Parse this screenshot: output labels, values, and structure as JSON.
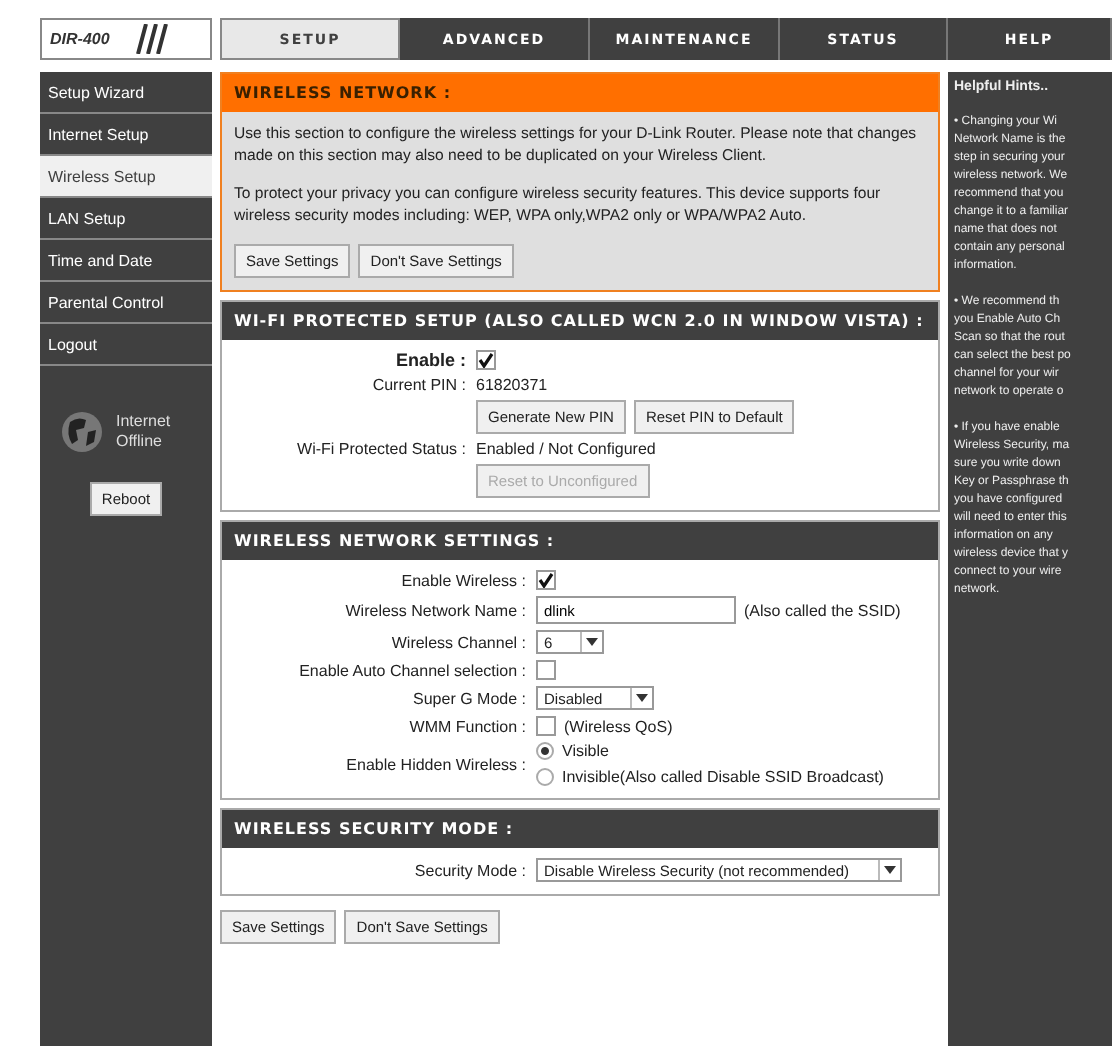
{
  "logo": {
    "model": "DIR-400"
  },
  "tabs": [
    {
      "label": "SETUP",
      "selected": true
    },
    {
      "label": "ADVANCED",
      "selected": false
    },
    {
      "label": "MAINTENANCE",
      "selected": false
    },
    {
      "label": "STATUS",
      "selected": false
    },
    {
      "label": "HELP",
      "selected": false
    }
  ],
  "sidebar": {
    "items": [
      {
        "label": "Setup Wizard",
        "selected": false
      },
      {
        "label": "Internet Setup",
        "selected": false
      },
      {
        "label": "Wireless Setup",
        "selected": true
      },
      {
        "label": "LAN Setup",
        "selected": false
      },
      {
        "label": "Time and Date",
        "selected": false
      },
      {
        "label": "Parental Control",
        "selected": false
      },
      {
        "label": "Logout",
        "selected": false
      }
    ],
    "status": [
      "Internet",
      "Offline"
    ],
    "reboot": "Reboot"
  },
  "wireless_network": {
    "title": "WIRELESS NETWORK :",
    "paragraphs": [
      "Use this section to configure the wireless settings for your D-Link Router. Please note that changes made on this section may also need to be duplicated on your Wireless Client.",
      "To protect your privacy you can configure wireless security features. This device supports four wireless security modes including: WEP, WPA only,WPA2 only or WPA/WPA2 Auto."
    ],
    "buttons": [
      {
        "label": "Save Settings",
        "disabled": false
      },
      {
        "label": "Don't Save Settings",
        "disabled": false
      }
    ]
  },
  "wps": {
    "title": "WI-FI PROTECTED SETUP (ALSO CALLED WCN 2.0 IN WINDOW VISTA) :",
    "rows": [
      {
        "kind": "checkbox",
        "label": "Enable :",
        "checked": true
      },
      {
        "kind": "text",
        "label": "Current PIN :",
        "value": "61820371"
      },
      {
        "kind": "buttons",
        "buttons": [
          {
            "label": "Generate New PIN",
            "disabled": false
          },
          {
            "label": "Reset PIN to Default",
            "disabled": false
          }
        ]
      },
      {
        "kind": "text",
        "label": "Wi-Fi Protected Status :",
        "value": "Enabled / Not Configured"
      },
      {
        "kind": "buttons",
        "buttons": [
          {
            "label": "Reset to Unconfigured",
            "disabled": true
          }
        ]
      }
    ]
  },
  "wireless_settings": {
    "title": "WIRELESS NETWORK SETTINGS :",
    "rows": [
      {
        "kind": "checkbox",
        "label": "Enable Wireless :",
        "checked": true
      },
      {
        "kind": "input",
        "label": "Wireless Network Name :",
        "value": "dlink",
        "note": "(Also called the SSID)"
      },
      {
        "kind": "select",
        "label": "Wireless Channel :",
        "value": "6"
      },
      {
        "kind": "checkbox",
        "label": "Enable Auto Channel selection :",
        "checked": false
      },
      {
        "kind": "select",
        "label": "Super G Mode :",
        "value": "Disabled"
      },
      {
        "kind": "checkbox",
        "label": "WMM Function :",
        "checked": false,
        "note": "(Wireless QoS)"
      },
      {
        "kind": "radio",
        "label": "Enable Hidden Wireless :",
        "options": [
          {
            "label": "Visible",
            "selected": true
          },
          {
            "label": "Invisible(Also called Disable SSID Broadcast)",
            "selected": false
          }
        ]
      }
    ]
  },
  "security": {
    "title": "WIRELESS SECURITY MODE :",
    "rows": [
      {
        "kind": "select",
        "label": "Security Mode :",
        "value": "Disable Wireless Security (not recommended)"
      }
    ]
  },
  "bottom_buttons": [
    {
      "label": "Save Settings",
      "disabled": false
    },
    {
      "label": "Don't Save Settings",
      "disabled": false
    }
  ],
  "help": {
    "title": "Helpful Hints..",
    "hints": [
      [
        "• Changing your Wi",
        "Network Name is the",
        "step in securing your",
        "wireless network. We",
        "recommend that you",
        "change it to a familiar",
        "name that does not",
        "contain any personal",
        "information."
      ],
      [
        "• We recommend th",
        "you Enable Auto Ch",
        "Scan so that the rout",
        "can select the best po",
        "channel for your wir",
        "network to operate o"
      ],
      [
        "• If you have enable",
        "Wireless Security, ma",
        "sure you write down",
        "Key or Passphrase th",
        "you have configured",
        "will need to enter this",
        "information on any",
        "wireless device that y",
        "connect to your wire",
        "network."
      ]
    ]
  }
}
